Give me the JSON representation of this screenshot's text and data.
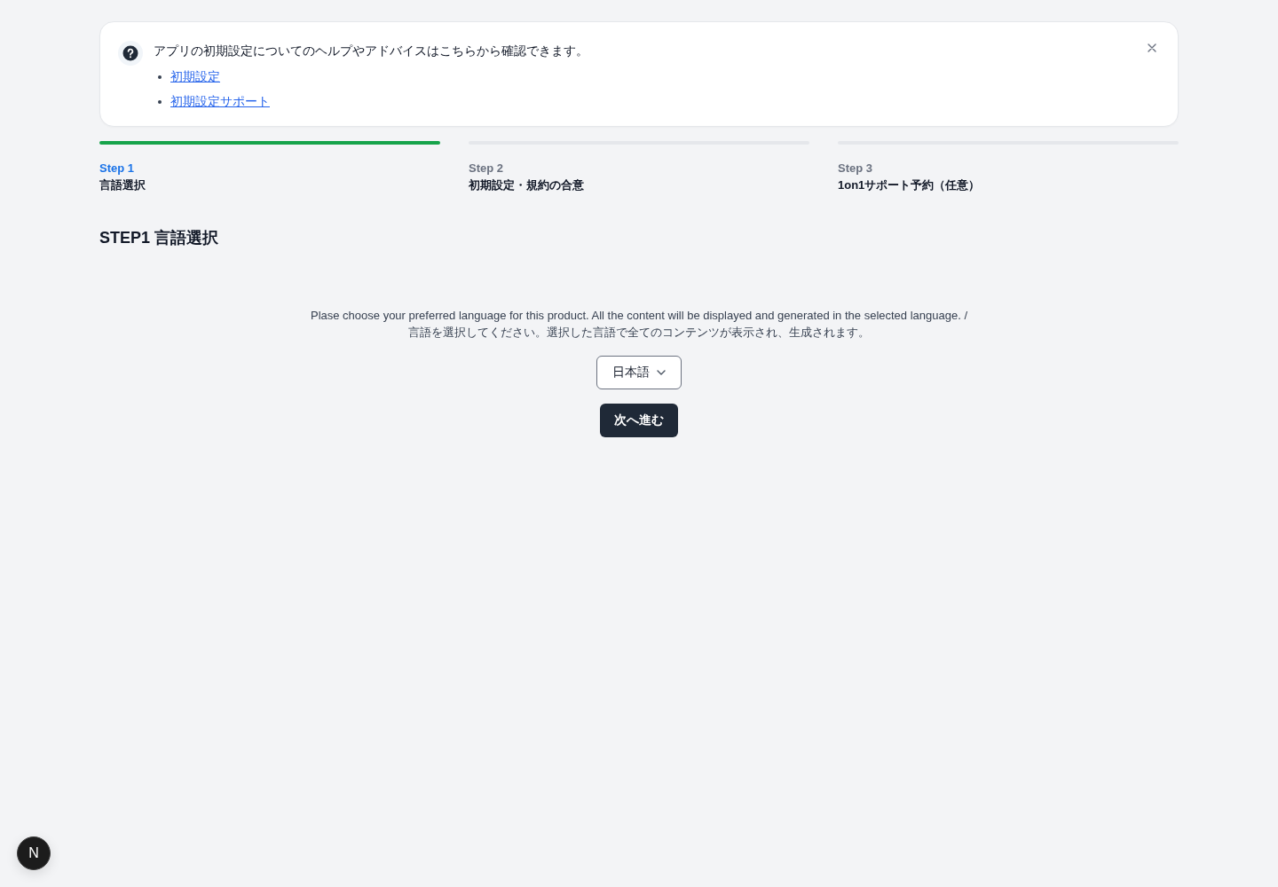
{
  "help_banner": {
    "message": "アプリの初期設定についてのヘルプやアドバイスはこちらから確認できます。",
    "links": [
      "初期設定",
      "初期設定サポート"
    ]
  },
  "steps": [
    {
      "label": "Step 1",
      "title": "言語選択",
      "selected": true
    },
    {
      "label": "Step 2",
      "title": "初期設定・規約の合意",
      "selected": false
    },
    {
      "label": "Step 3",
      "title": "1on1サポート予約（任意）",
      "selected": false
    }
  ],
  "heading": "STEP1 言語選択",
  "description": [
    "Plase choose your preferred language for this product. All the content will be displayed and generated in the selected language. /",
    "言語を選択してください。選択した言語で全てのコンテンツが表示され、生成されます。"
  ],
  "language_select": {
    "value": "日本語"
  },
  "next_button": {
    "label": "次へ進む"
  },
  "dev_badge": {
    "label": "N"
  }
}
